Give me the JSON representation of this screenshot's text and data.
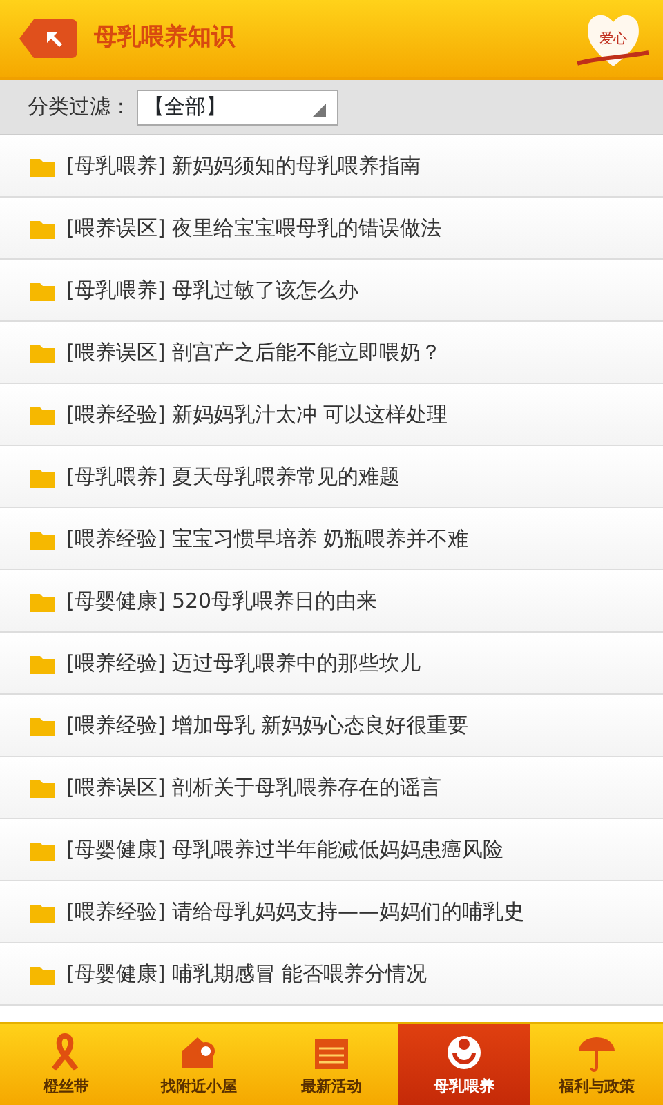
{
  "header": {
    "title": "母乳喂养知识",
    "logo_text": "爱心"
  },
  "filter": {
    "label": "分类过滤：",
    "value": "【全部】"
  },
  "articles": [
    {
      "category": "[母乳喂养]",
      "title": "新妈妈须知的母乳喂养指南"
    },
    {
      "category": "[喂养误区]",
      "title": "夜里给宝宝喂母乳的错误做法"
    },
    {
      "category": "[母乳喂养]",
      "title": "母乳过敏了该怎么办"
    },
    {
      "category": "[喂养误区]",
      "title": "剖宫产之后能不能立即喂奶？"
    },
    {
      "category": "[喂养经验]",
      "title": "新妈妈乳汁太冲 可以这样处理"
    },
    {
      "category": "[母乳喂养]",
      "title": "夏天母乳喂养常见的难题"
    },
    {
      "category": "[喂养经验]",
      "title": "宝宝习惯早培养 奶瓶喂养并不难"
    },
    {
      "category": "[母婴健康]",
      "title": "520母乳喂养日的由来"
    },
    {
      "category": "[喂养经验]",
      "title": "迈过母乳喂养中的那些坎儿"
    },
    {
      "category": "[喂养经验]",
      "title": "增加母乳 新妈妈心态良好很重要"
    },
    {
      "category": "[喂养误区]",
      "title": "剖析关于母乳喂养存在的谣言"
    },
    {
      "category": "[母婴健康]",
      "title": "母乳喂养过半年能减低妈妈患癌风险"
    },
    {
      "category": "[喂养经验]",
      "title": "请给母乳妈妈支持——妈妈们的哺乳史"
    },
    {
      "category": "[母婴健康]",
      "title": "哺乳期感冒 能否喂养分情况"
    }
  ],
  "tabs": [
    {
      "kind": "ribbon",
      "label": "橙丝带",
      "selected": false
    },
    {
      "kind": "house",
      "label": "找附近小屋",
      "selected": false
    },
    {
      "kind": "calendar",
      "label": "最新活动",
      "selected": false
    },
    {
      "kind": "mother",
      "label": "母乳喂养",
      "selected": true
    },
    {
      "kind": "umbrella",
      "label": "福利与政策",
      "selected": false
    }
  ]
}
